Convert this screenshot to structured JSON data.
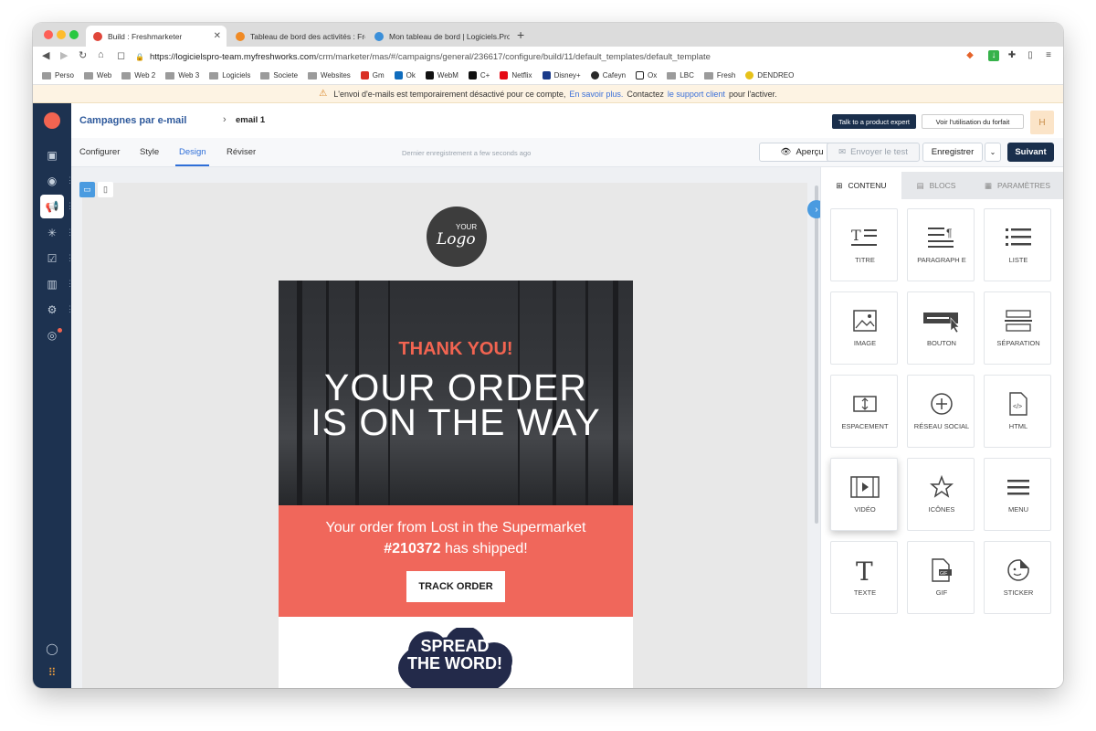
{
  "browser": {
    "tabs": [
      {
        "title": "Build : Freshmarketer",
        "close": "✕"
      },
      {
        "title": "Tableau de bord des activités : Fres"
      },
      {
        "title": "Mon tableau de bord | Logiciels.Pro"
      }
    ],
    "new_tab": "+",
    "url_host": "https://logicielspro-team.myfreshworks.com",
    "url_path": "/crm/marketer/mas/#/campaigns/general/236617/configure/build/11/default_templates/default_template"
  },
  "bookmarks": [
    "Perso",
    "Web",
    "Web 2",
    "Web 3",
    "Logiciels",
    "Societe",
    "Websites",
    "Gm",
    "Ok",
    "WebM",
    "C+",
    "Netflix",
    "Disney+",
    "Cafeyn",
    "Ox",
    "LBC",
    "Fresh",
    "DENDREO"
  ],
  "alert": {
    "text1": "L'envoi d'e-mails est temporairement désactivé pour ce compte,",
    "link1": "En savoir plus.",
    "text2": "Contactez",
    "link2": "le support client",
    "text3": "pour l'activer."
  },
  "header": {
    "breadcrumb": "Campagnes par e-mail",
    "sep": "›",
    "current": "email 1",
    "talk_btn": "Talk to a product expert",
    "usage_btn": "Voir l'utilisation du forfait",
    "avatar": "H"
  },
  "steps": {
    "tabs": [
      "Configurer",
      "Style",
      "Design",
      "Réviser"
    ],
    "saved": "Dernier enregistrement a few seconds ago",
    "apercu": "Aperçu",
    "test": "Envoyer le test",
    "save": "Enregistrer",
    "next": "Suivant"
  },
  "email": {
    "logo_top": "YOUR",
    "logo_main": "Logo",
    "thanks": "THANK YOU!",
    "order_line1": "YOUR ORDER",
    "order_line2": "IS ON THE WAY",
    "ship_line1": "Your order from Lost in the Supermarket",
    "ship_num": "#210372",
    "ship_rest": "has shipped!",
    "track_btn": "TRACK ORDER",
    "spread1": "SPREAD",
    "spread2": "THE WORD!"
  },
  "panel": {
    "tabs": [
      "CONTENU",
      "BLOCS",
      "PARAMÈTRES"
    ],
    "tiles": [
      {
        "label": "TITRE",
        "icon": "title-icon"
      },
      {
        "label": "PARAGRAPH E",
        "icon": "paragraph-icon"
      },
      {
        "label": "LISTE",
        "icon": "list-icon"
      },
      {
        "label": "IMAGE",
        "icon": "image-icon"
      },
      {
        "label": "BOUTON",
        "icon": "button-icon"
      },
      {
        "label": "SÉPARATION",
        "icon": "separator-icon"
      },
      {
        "label": "ESPACEMENT",
        "icon": "spacing-icon"
      },
      {
        "label": "RÉSEAU SOCIAL",
        "icon": "social-icon"
      },
      {
        "label": "HTML",
        "icon": "html-icon"
      },
      {
        "label": "VIDÉO",
        "icon": "video-icon"
      },
      {
        "label": "ICÔNES",
        "icon": "star-icon"
      },
      {
        "label": "MENU",
        "icon": "menu-icon"
      },
      {
        "label": "TEXTE",
        "icon": "text-icon"
      },
      {
        "label": "GIF",
        "icon": "gif-icon"
      },
      {
        "label": "STICKER",
        "icon": "sticker-icon"
      }
    ]
  },
  "colors": {
    "sidebar": "#1d3250",
    "accent_blue": "#2f6fd8",
    "coral": "#f0675b",
    "navy_button": "#1a2f4c"
  }
}
